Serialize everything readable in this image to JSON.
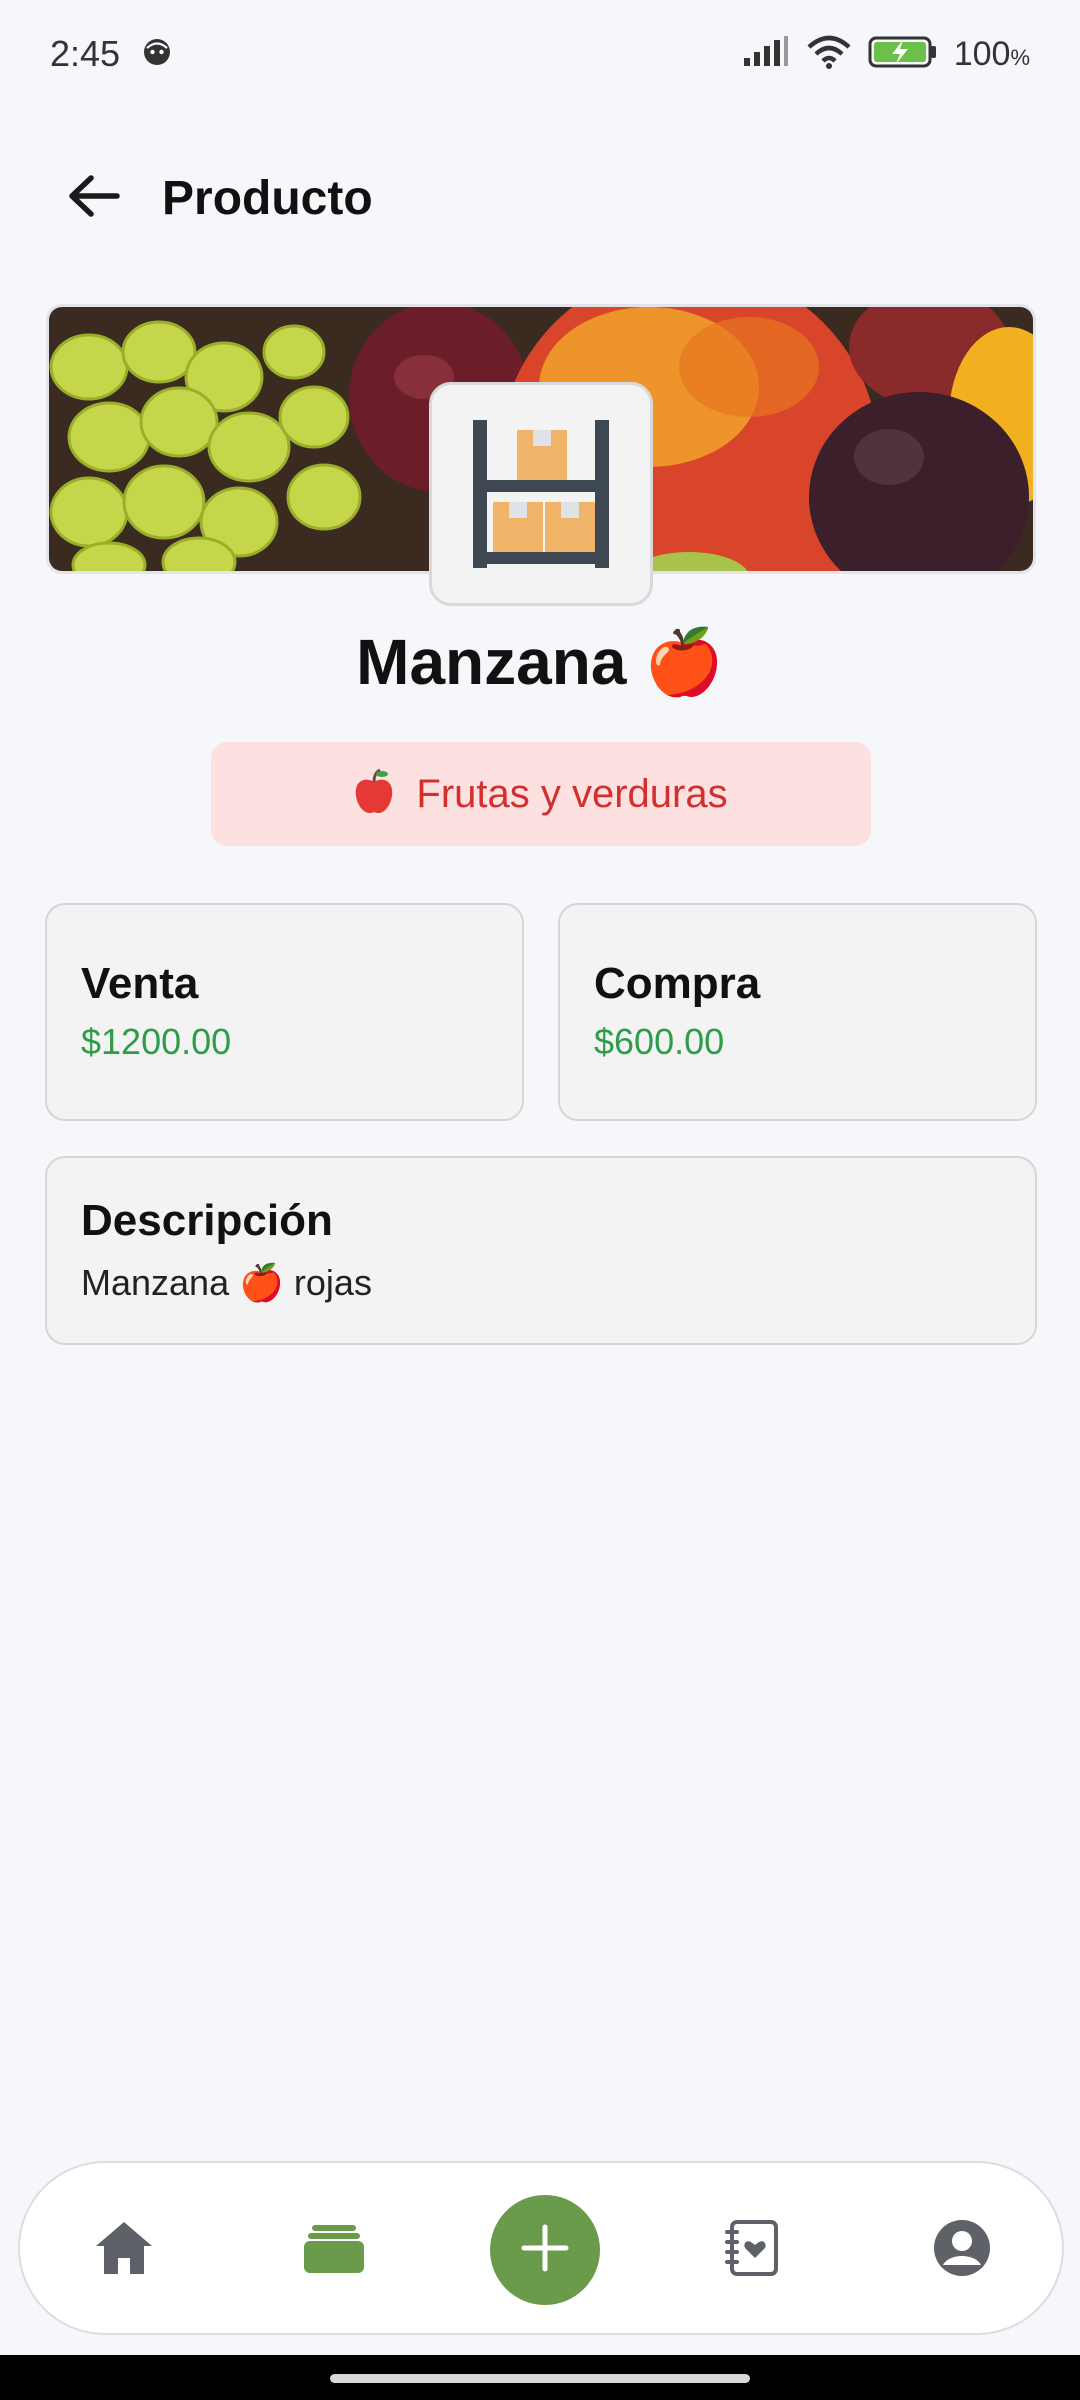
{
  "status_bar": {
    "time": "2:45",
    "battery_level": "100",
    "battery_unit": "%",
    "icons": [
      "face-icon",
      "signal-icon",
      "wifi-icon",
      "battery-charging-icon"
    ]
  },
  "header": {
    "title": "Producto",
    "back_icon": "arrow-left-icon"
  },
  "product": {
    "banner_image": "fruits-banner",
    "icon": "warehouse-shelf-icon",
    "name": "Manzana 🍎",
    "category_icon": "apple-icon",
    "category": "Frutas y verduras",
    "prices": {
      "sale_label": "Venta",
      "sale_value": "$1200.00",
      "purchase_label": "Compra",
      "purchase_value": "$600.00"
    },
    "description_label": "Descripción",
    "description": "Manzana 🍎 rojas"
  },
  "bottom_nav": {
    "items": [
      "home-icon",
      "inventory-icon",
      "add-icon",
      "contacts-book-icon",
      "profile-icon"
    ],
    "accent_color": "#6a9b4a"
  },
  "colors": {
    "background": "#f6f7fb",
    "price_green": "#2e9d4a",
    "category_red": "#d32f2f",
    "category_bg": "#fde1e1"
  }
}
